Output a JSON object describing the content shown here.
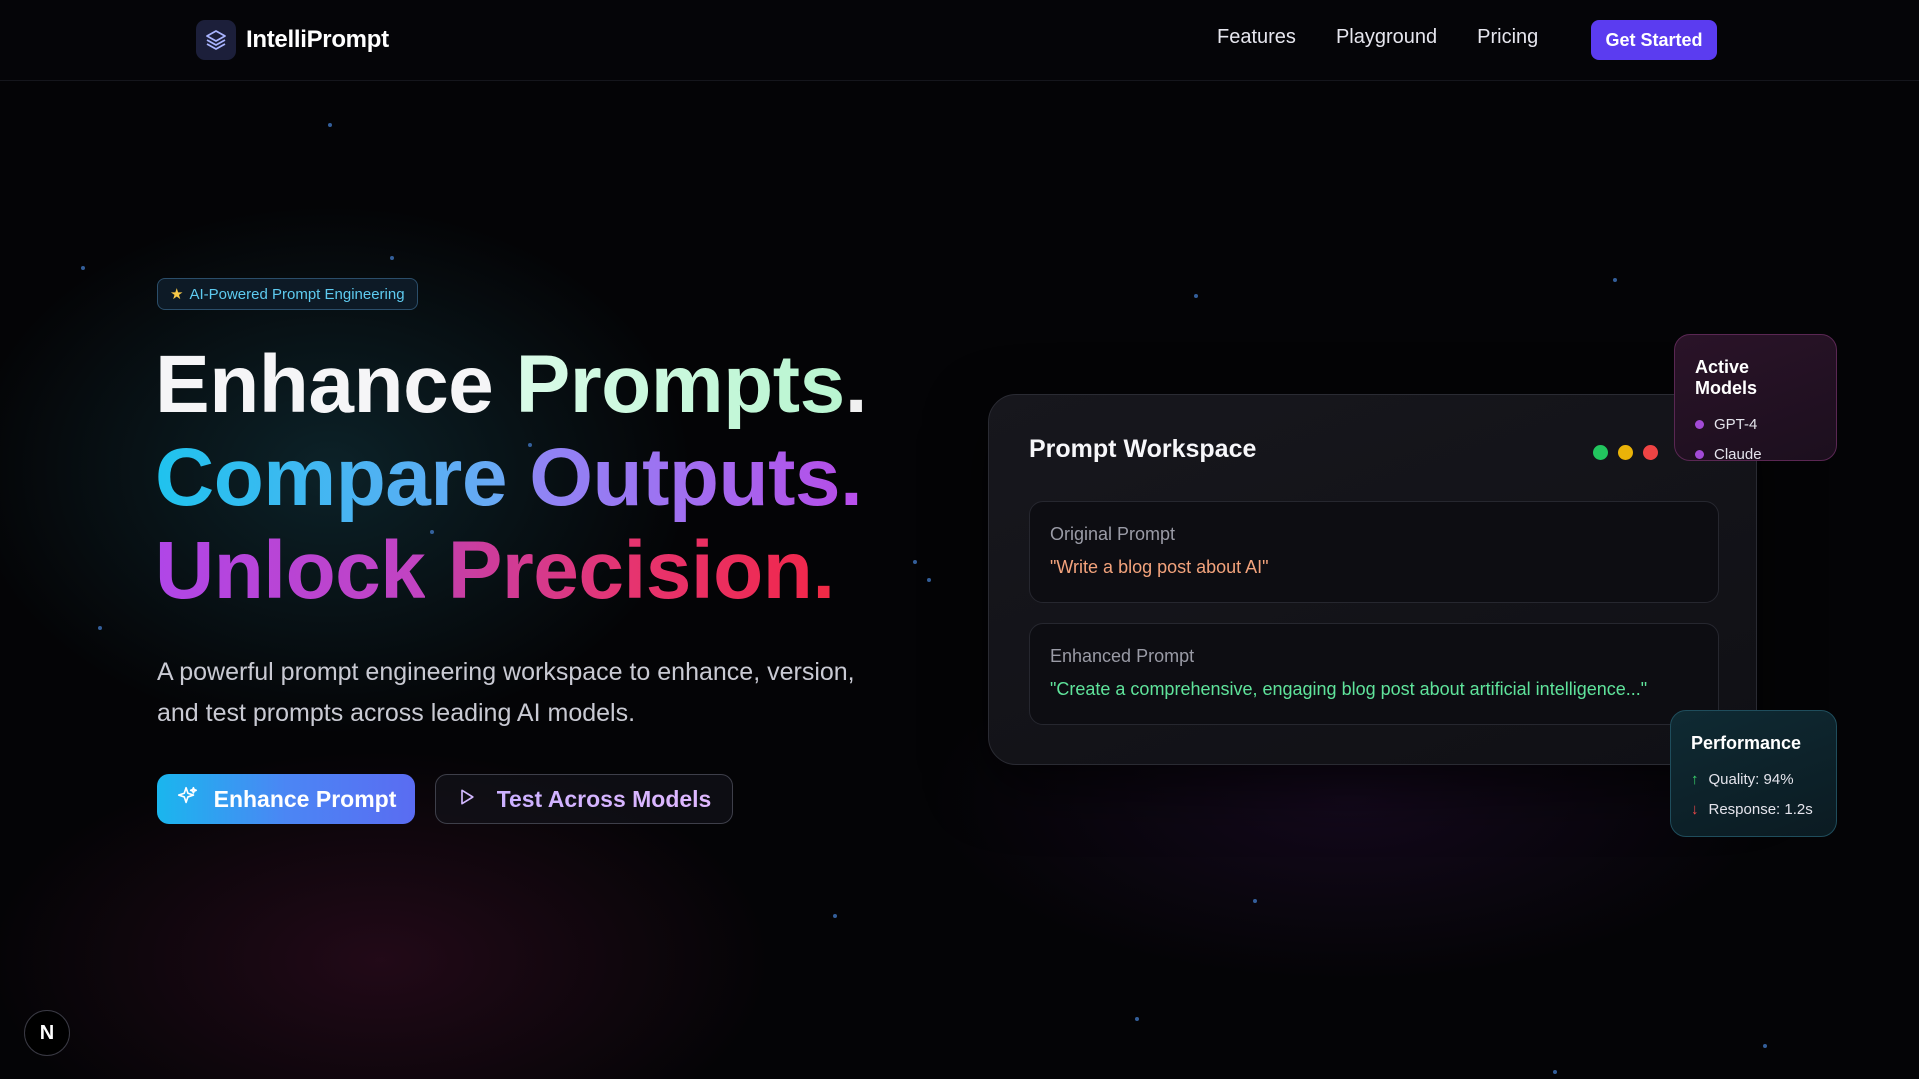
{
  "nav": {
    "brand": "IntelliPrompt",
    "links": [
      "Features",
      "Playground",
      "Pricing"
    ],
    "cta": "Get Started"
  },
  "hero": {
    "badge": "AI-Powered Prompt Engineering",
    "line1": {
      "word1": "Enhance",
      "word2": "Prompts",
      "dot": "."
    },
    "line2": {
      "word1": "Compare",
      "word2": "Outputs",
      "dot": "."
    },
    "line3": {
      "word1": "Unlock",
      "word2": "Precision",
      "dot": "."
    },
    "lede_1": "A powerful prompt engineering workspace to enhance, version,",
    "lede_2": "and test prompts across leading AI models.",
    "primary_button": "Enhance Prompt",
    "secondary_button": "Test Across Models"
  },
  "workspace": {
    "title": "Prompt Workspace",
    "dot_colors": [
      "#22c55e",
      "#eab308",
      "#ef4444"
    ],
    "original": {
      "label": "Original Prompt",
      "text": "\"Write a blog post about AI\""
    },
    "enhanced": {
      "label": "Enhanced Prompt",
      "text": "\"Create a comprehensive, engaging blog post about artificial intelligence...\""
    }
  },
  "active_models": {
    "title": "Active Models",
    "items": [
      "GPT-4",
      "Claude"
    ]
  },
  "performance": {
    "title": "Performance",
    "quality": "Quality: 94%",
    "response": "Response: 1.2s"
  },
  "corner_badge": "N",
  "colors": {
    "accent": "#5b3cf0",
    "primary_gradient_start": "#1ab6ee",
    "original_text": "#f3a37c",
    "enhanced_text": "#5fe39b"
  }
}
